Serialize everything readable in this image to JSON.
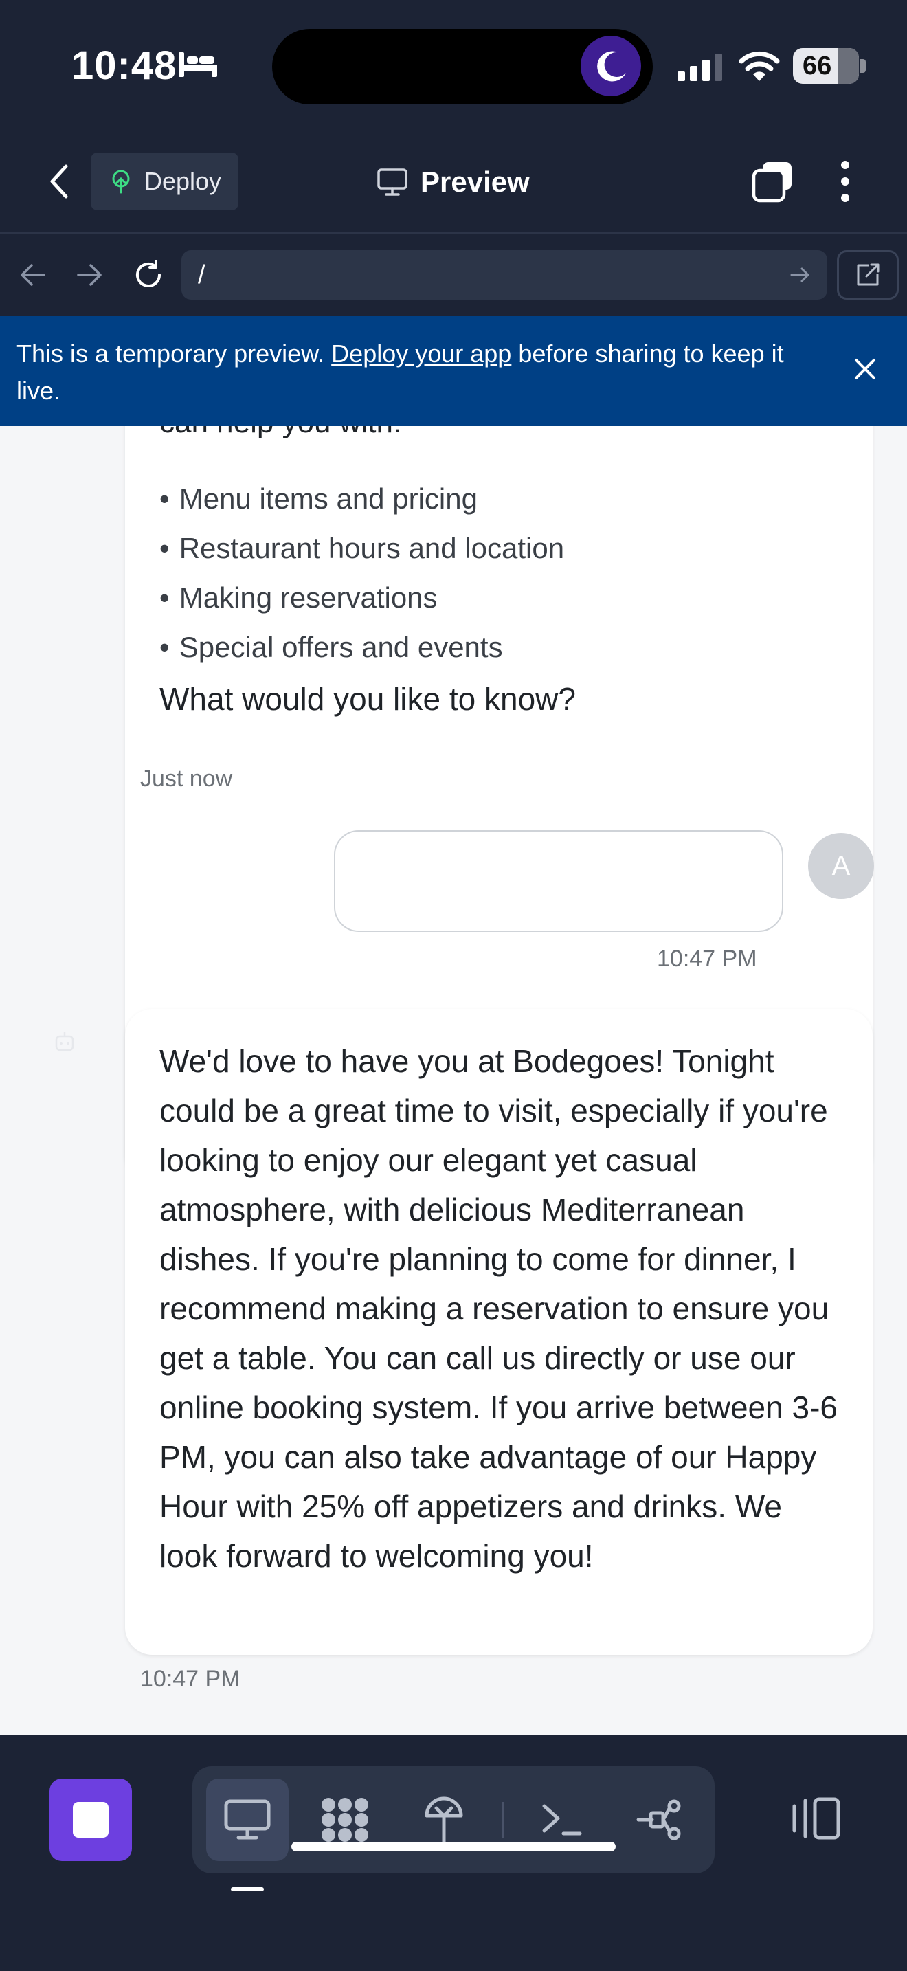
{
  "status_bar": {
    "time": "10:48",
    "battery": "66"
  },
  "header": {
    "deploy_label": "Deploy",
    "title": "Preview"
  },
  "url_bar": {
    "path": "/"
  },
  "banner": {
    "text_before": "This is a temporary preview.",
    "link": "Deploy your app",
    "text_after": "before sharing to keep it live."
  },
  "chat": {
    "bot_partial_line": "can help you with:",
    "bot_list": [
      "Menu items and pricing",
      "Restaurant hours and location",
      "Making reservations",
      "Special offers and events"
    ],
    "bot_question": "What would you like to know?",
    "bot_timestamp_1": "Just now",
    "user_avatar": "A",
    "user_timestamp": "10:47 PM",
    "bot_reply": "We'd love to have you at Bodegoes! Tonight could be a great time to visit, especially if you're looking to enjoy our elegant yet casual atmosphere, with delicious Mediterranean dishes. If you're planning to come for dinner, I recommend making a reservation to ensure you get a table. You can call us directly or use our online booking system. If you arrive between 3-6 PM, you can also take advantage of our Happy Hour with 25% off appetizers and drinks. We look forward to welcoming you!",
    "bot_timestamp_2": "10:47 PM"
  },
  "colors": {
    "nav_bg": "#1c2335",
    "banner_bg": "#004085",
    "accent": "#6d3fe0",
    "chat_bg": "#f5f6f8"
  }
}
